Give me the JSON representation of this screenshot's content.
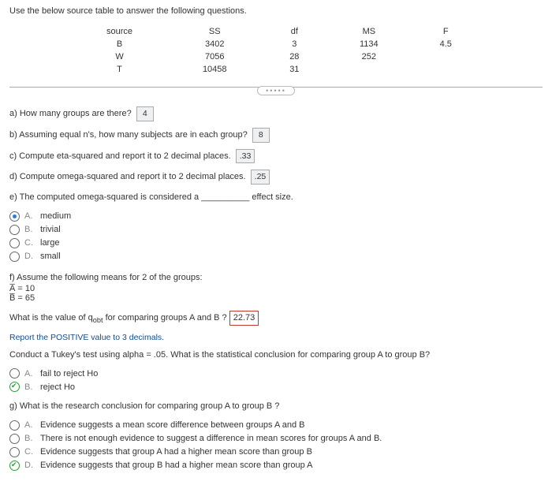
{
  "prompt": "Use the below source table to answer the following questions.",
  "table": {
    "headers": [
      "source",
      "SS",
      "df",
      "MS",
      "F"
    ],
    "rows": [
      [
        "B",
        "3402",
        "3",
        "1134",
        "4.5"
      ],
      [
        "W",
        "7056",
        "28",
        "252",
        ""
      ],
      [
        "T",
        "10458",
        "31",
        "",
        ""
      ]
    ]
  },
  "qa": {
    "a": {
      "text": "a) How many groups are there?",
      "ans": "4"
    },
    "b": {
      "text": "b) Assuming equal n's, how many subjects are in each group?",
      "ans": "8"
    },
    "c": {
      "text": "c) Compute eta-squared and report it to 2 decimal places.",
      "ans": ".33"
    },
    "d": {
      "text": "d) Compute omega-squared and report it to 2 decimal places.",
      "ans": ".25"
    }
  },
  "qe": {
    "pre": "e) The computed omega-squared is considered a",
    "post": " effect size.",
    "blank": "__________",
    "options": [
      {
        "letter": "A.",
        "label": "medium",
        "selected": true
      },
      {
        "letter": "B.",
        "label": "trivial",
        "selected": false
      },
      {
        "letter": "C.",
        "label": "large",
        "selected": false
      },
      {
        "letter": "D.",
        "label": "small",
        "selected": false
      }
    ]
  },
  "qf": {
    "text": "f) Assume the following means for 2 of the groups:",
    "meanA": "A̅ = 10",
    "meanB": "B̅ = 65",
    "q_pre": "What is the value of q",
    "q_sub": "obt",
    "q_post": " for comparing groups A and B ?",
    "ans": "22.73",
    "note": "Report the POSITIVE value to 3 decimals.",
    "tukey": "Conduct a Tukey's test using alpha = .05. What is the statistical conclusion for comparing group A to group B?",
    "options": [
      {
        "letter": "A.",
        "label": "fail to reject Ho",
        "selected": false,
        "check": false
      },
      {
        "letter": "B.",
        "label": "reject Ho",
        "selected": false,
        "check": true
      }
    ]
  },
  "qg": {
    "text": "g) What is the research conclusion for comparing group A to group B ?",
    "options": [
      {
        "letter": "A.",
        "label": "Evidence suggests a mean score difference between groups A and B",
        "check": false
      },
      {
        "letter": "B.",
        "label": "There is not enough evidence to suggest a difference in mean scores for groups A and B.",
        "check": false
      },
      {
        "letter": "C.",
        "label": "Evidence suggests that group A had a higher mean score than group B",
        "check": false
      },
      {
        "letter": "D.",
        "label": "Evidence suggests that group B had a higher mean score than group A",
        "check": true
      }
    ]
  }
}
